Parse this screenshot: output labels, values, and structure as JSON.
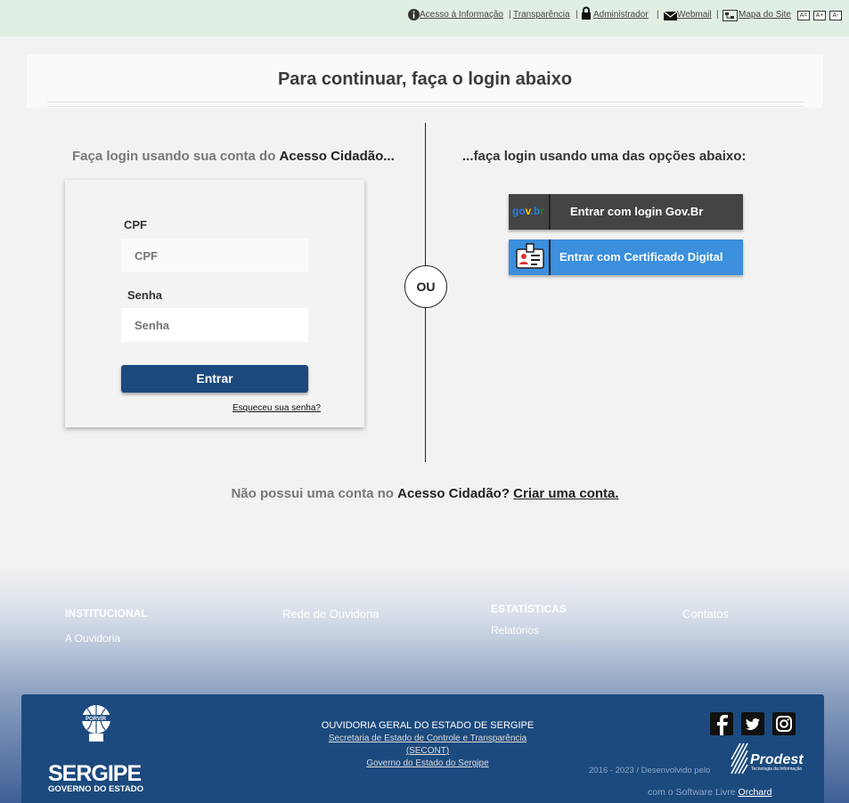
{
  "topbar": {
    "links": [
      "Acesso à Informação",
      "Transparência",
      "Administrador",
      "Webmail",
      "Mapa do Site"
    ],
    "font_buttons": [
      "A=",
      "A+",
      "A-"
    ]
  },
  "login": {
    "title": "Para continuar, faça o login abaixo",
    "left_heading_prefix": "Faça login usando sua conta do ",
    "left_heading_bold": "Acesso Cidadão...",
    "right_heading": "...faça login usando uma das opções abaixo:",
    "cpf_label": "CPF",
    "cpf_placeholder": "CPF",
    "senha_label": "Senha",
    "senha_placeholder": "Senha",
    "entrar": "Entrar",
    "forgot": "Esqueceu sua senha?",
    "ou": "OU",
    "govbr_button": "Entrar com login Gov.Br",
    "govbr_logo": "gov.br",
    "cert_button": "Entrar com Certificado Digital",
    "no_account_prefix": "Não possui uma conta no ",
    "no_account_bold": "Acesso Cidadão?",
    "create_account": "Criar uma conta."
  },
  "footer": {
    "institucional": "INSTITUCIONAL",
    "a_ouvidoria": "A Ouvidoria",
    "rede": "Rede de Ouvidoria",
    "estatisticas": "ESTATÍSTICAS",
    "relatorios": "Relatórios",
    "contatos": "Contatos",
    "org_name": "OUVIDORIA GERAL DO ESTADO DE SERGIPE",
    "secretaria": "Secretaria de Estado de Controle e Transparência",
    "seccont": "(SECONT)",
    "governo": "Governo do Estado do Sergipe",
    "brand": "SERGIPE",
    "brand_sub": "GOVERNO DO ESTADO",
    "porvir": "PORVIR",
    "dev_text": "2016 - 2023 / Desenvolvido pelo",
    "prodest": "Prodest",
    "prodest_sub": "Tecnologia da Informação",
    "software_text": "com o Software Livre ",
    "orchard": "Orchard",
    "social": [
      "facebook-icon",
      "twitter-icon",
      "instagram-icon"
    ]
  }
}
